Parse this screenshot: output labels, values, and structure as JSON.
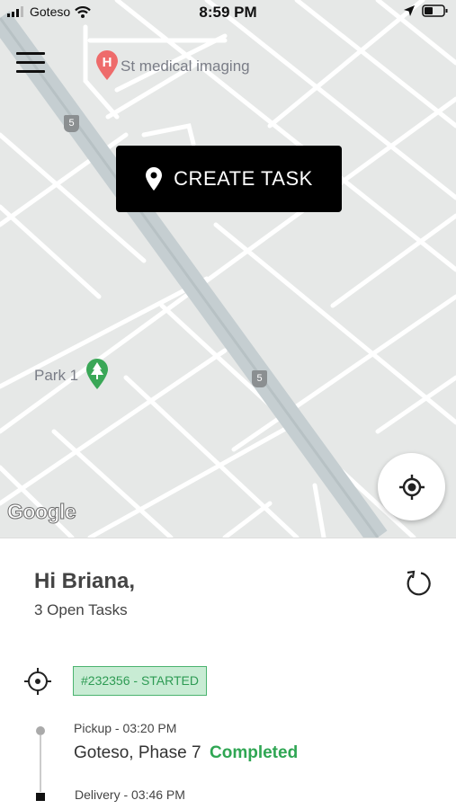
{
  "status_bar": {
    "carrier": "Goteso",
    "time": "8:59 PM"
  },
  "map": {
    "poi_label": "St medical imaging",
    "park_label": "Park 1",
    "route_shield_top": "5",
    "route_shield_bottom": "5",
    "attribution": "Google"
  },
  "create_task": {
    "label": "CREATE TASK"
  },
  "panel": {
    "greeting": "Hi Briana,",
    "open_tasks": "3 Open Tasks",
    "task": {
      "badge": "#232356 - STARTED",
      "pickup_label": "Pickup - 03:20 PM",
      "pickup_location": "Goteso, Phase 7",
      "pickup_status": "Completed",
      "delivery_label": "Delivery - 03:46 PM"
    }
  },
  "colors": {
    "map_background": "#e6e8e7",
    "highway": "#c5ced1",
    "badge_fill": "#c8ecd4",
    "badge_border": "#4bb36f",
    "completed": "#2fa653",
    "poi_red": "#ee6b6b",
    "park_green": "#3aa757"
  },
  "icons": {
    "menu": "hamburger-icon",
    "create_task": "location-pin-icon",
    "locate": "crosshair-icon",
    "refresh": "refresh-icon",
    "task": "target-icon"
  }
}
